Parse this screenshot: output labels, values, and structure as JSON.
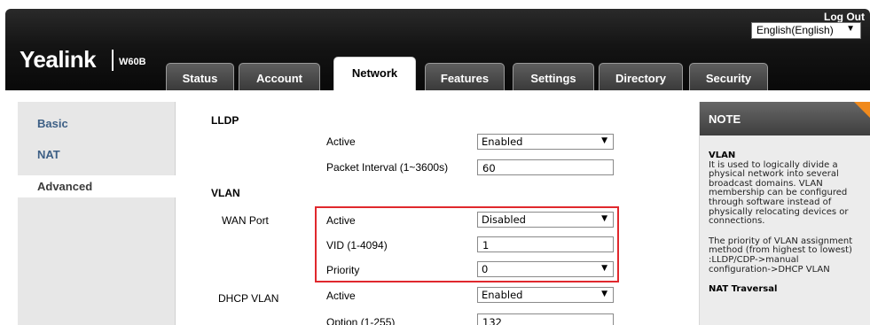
{
  "header": {
    "logout_label": "Log Out",
    "language": "English(English)",
    "logo": "Yealink",
    "model": "W60B"
  },
  "tabs": [
    {
      "label": "Status"
    },
    {
      "label": "Account"
    },
    {
      "label": "Network",
      "active": true
    },
    {
      "label": "Features"
    },
    {
      "label": "Settings"
    },
    {
      "label": "Directory"
    },
    {
      "label": "Security"
    }
  ],
  "sidebar": {
    "items": [
      {
        "label": "Basic"
      },
      {
        "label": "NAT"
      },
      {
        "label": "Advanced",
        "active": true
      }
    ]
  },
  "lldp": {
    "section": "LLDP",
    "active_label": "Active",
    "active_value": "Enabled",
    "interval_label": "Packet Interval (1~3600s)",
    "interval_value": "60"
  },
  "vlan": {
    "section": "VLAN",
    "wan_port": {
      "group": "WAN Port",
      "active_label": "Active",
      "active_value": "Disabled",
      "vid_label": "VID (1-4094)",
      "vid_value": "1",
      "priority_label": "Priority",
      "priority_value": "0"
    },
    "dhcp_vlan": {
      "group": "DHCP VLAN",
      "active_label": "Active",
      "active_value": "Enabled",
      "option_label": "Option (1-255)",
      "option_value": "132"
    }
  },
  "note": {
    "heading": "NOTE",
    "vlan_title": "VLAN",
    "vlan_lines": [
      "It is used to logically divide a",
      "physical network into several",
      "broadcast domains. VLAN",
      "membership can be configured",
      "through software instead of",
      "physically relocating devices or",
      "connections."
    ],
    "priority_lines": [
      "The priority of VLAN assignment",
      "method (from highest to lowest)",
      ":LLDP/CDP->manual",
      "configuration->DHCP VLAN"
    ],
    "nat_title": "NAT Traversal"
  },
  "colors": {
    "highlight_border": "#e0282d",
    "note_corner": "#f08a1d",
    "sidebar_link": "#3d5f85"
  }
}
